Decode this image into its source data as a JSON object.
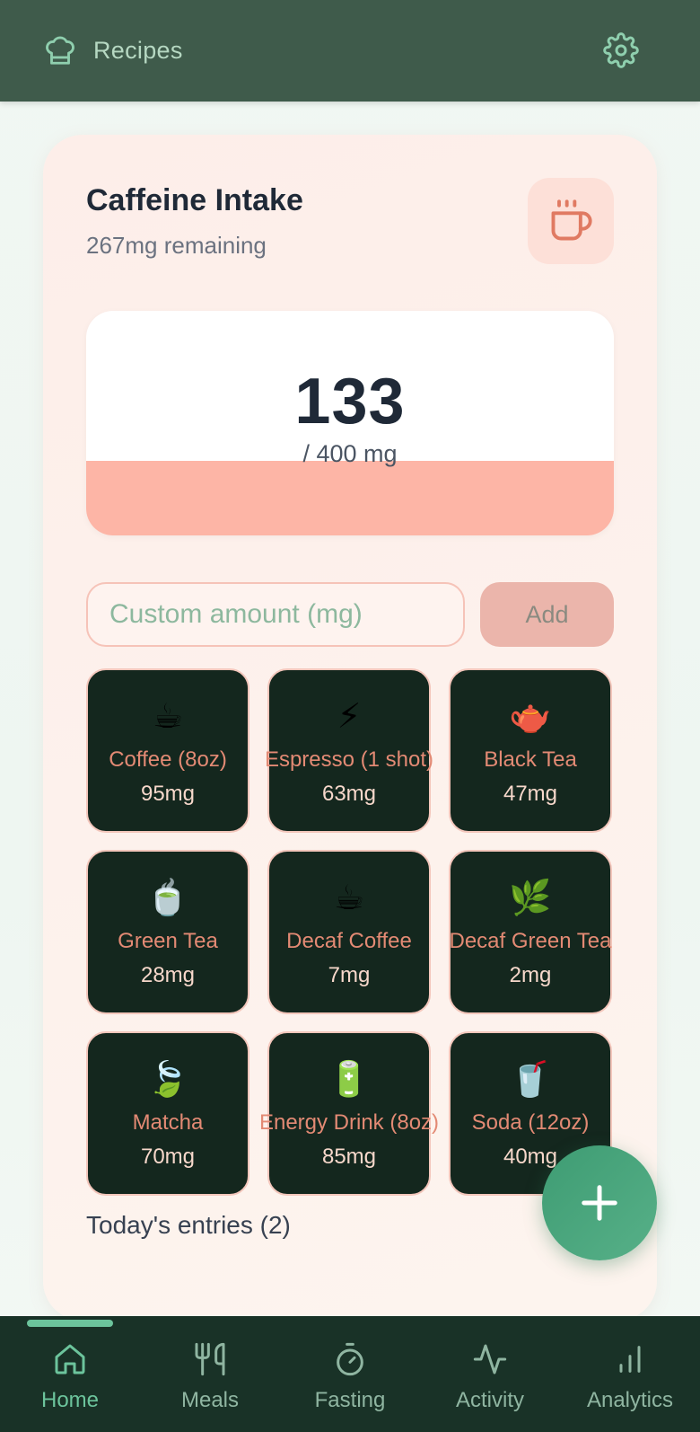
{
  "header": {
    "recipes_label": "Recipes",
    "recipes_icon": "chef-hat-icon",
    "settings_icon": "gear-icon"
  },
  "caffeine": {
    "title": "Caffeine Intake",
    "remaining": "267mg remaining",
    "icon": "coffee-cup-icon",
    "value": "133",
    "max_label": "/ 400 mg",
    "progress_fraction": 0.3325,
    "custom_placeholder": "Custom amount (mg)",
    "add_label": "Add"
  },
  "drinks": [
    {
      "icon": "☕",
      "name": "Coffee (8oz)",
      "mg": "95mg"
    },
    {
      "icon": "⚡",
      "name": "Espresso (1 shot)",
      "mg": "63mg"
    },
    {
      "icon": "🫖",
      "name": "Black Tea",
      "mg": "47mg"
    },
    {
      "icon": "🍵",
      "name": "Green Tea",
      "mg": "28mg"
    },
    {
      "icon": "☕",
      "name": "Decaf Coffee",
      "mg": "7mg"
    },
    {
      "icon": "🌿",
      "name": "Decaf Green Tea",
      "mg": "2mg"
    },
    {
      "icon": "🍃",
      "name": "Matcha",
      "mg": "70mg"
    },
    {
      "icon": "🔋",
      "name": "Energy Drink (8oz)",
      "mg": "85mg"
    },
    {
      "icon": "🥤",
      "name": "Soda (12oz)",
      "mg": "40mg"
    }
  ],
  "entries": {
    "label": "Today's entries (2)"
  },
  "fab_icon": "plus-icon",
  "nav": [
    {
      "label": "Home",
      "icon": "home-icon",
      "active": true
    },
    {
      "label": "Meals",
      "icon": "utensils-icon",
      "active": false
    },
    {
      "label": "Fasting",
      "icon": "timer-icon",
      "active": false
    },
    {
      "label": "Activity",
      "icon": "activity-icon",
      "active": false
    },
    {
      "label": "Analytics",
      "icon": "bar-chart-icon",
      "active": false
    }
  ],
  "colors": {
    "header_bg": "#3f5b4b",
    "accent_green": "#6cc49c",
    "card_bg": "#fdeee9",
    "gauge_fill": "#fdb5a6",
    "tile_bg": "#14271e",
    "tile_name": "#e38a74",
    "nav_bg": "#193227"
  }
}
